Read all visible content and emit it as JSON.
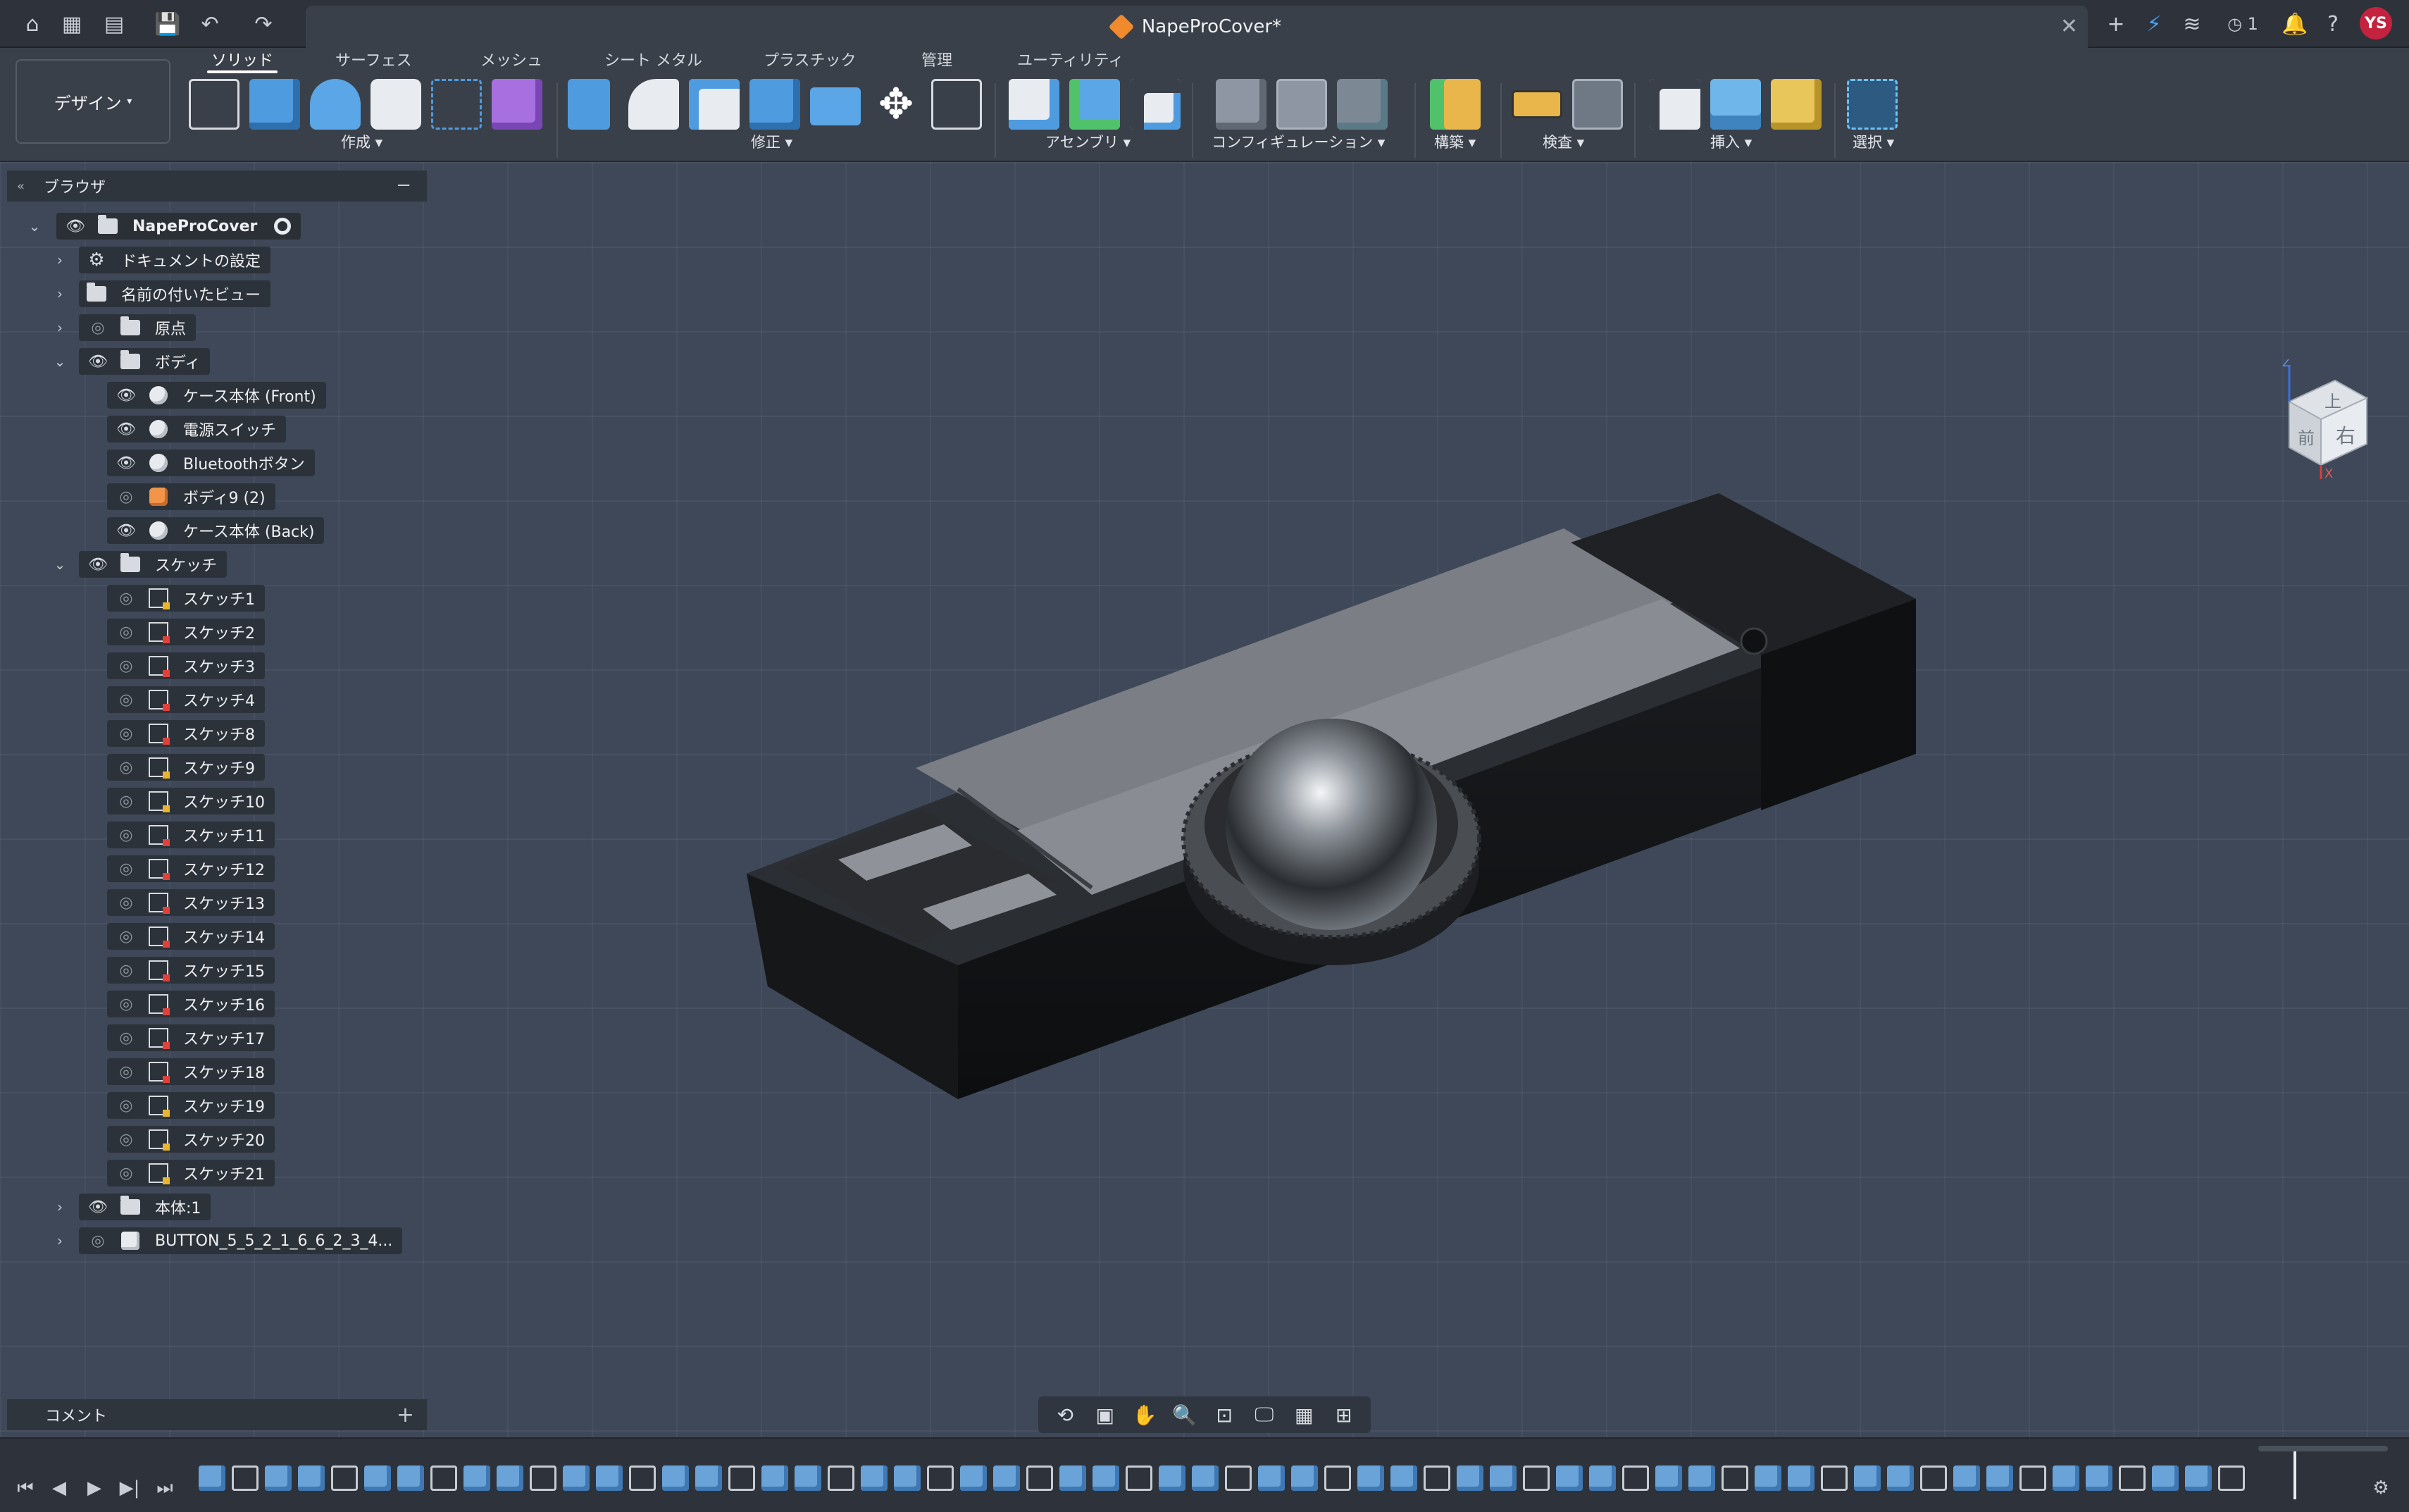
{
  "app": {
    "doc_title": "NapeProCover*",
    "notifications_count": "1",
    "user_initials": "YS"
  },
  "toolbar": {
    "workspace": "デザイン",
    "tabs": [
      "ソリッド",
      "サーフェス",
      "メッシュ",
      "シート メタル",
      "プラスチック",
      "管理",
      "ユーティリティ"
    ],
    "groups": {
      "create": "作成",
      "modify": "修正",
      "assembly": "アセンブリ",
      "configuration": "コンフィギュレーション",
      "construct": "構築",
      "inspect": "検査",
      "insert": "挿入",
      "select": "選択"
    }
  },
  "browser": {
    "title": "ブラウザ",
    "root": "NapeProCover",
    "items": [
      {
        "label": "ドキュメントの設定",
        "type": "gear"
      },
      {
        "label": "名前の付いたビュー",
        "type": "folder"
      },
      {
        "label": "原点",
        "type": "folder",
        "visible": false
      },
      {
        "label": "ボディ",
        "type": "folder",
        "visible": true,
        "expanded": true
      }
    ],
    "bodies": [
      {
        "label": "ケース本体 (Front)",
        "visible": true
      },
      {
        "label": "電源スイッチ",
        "visible": true
      },
      {
        "label": "Bluetoothボタン",
        "visible": true
      },
      {
        "label": "ボディ9 (2)",
        "visible": false,
        "color": "orange"
      },
      {
        "label": "ケース本体 (Back)",
        "visible": true
      }
    ],
    "sketch_folder": "スケッチ",
    "sketches": [
      "スケッチ1",
      "スケッチ2",
      "スケッチ3",
      "スケッチ4",
      "スケッチ8",
      "スケッチ9",
      "スケッチ10",
      "スケッチ11",
      "スケッチ12",
      "スケッチ13",
      "スケッチ14",
      "スケッチ15",
      "スケッチ16",
      "スケッチ17",
      "スケッチ18",
      "スケッチ19",
      "スケッチ20",
      "スケッチ21"
    ],
    "component": "本体:1",
    "button_component": "BUTTON_5_5_2_1_6_6_2_3_4..."
  },
  "comments": {
    "title": "コメント"
  },
  "viewcube": {
    "top": "上",
    "front": "前",
    "right": "右",
    "z_axis": "Z",
    "x_axis": "X"
  },
  "colors": {
    "accent_orange": "#f08a2c",
    "avatar": "#c4233f",
    "timeline_feature": "#6aa3d8"
  }
}
